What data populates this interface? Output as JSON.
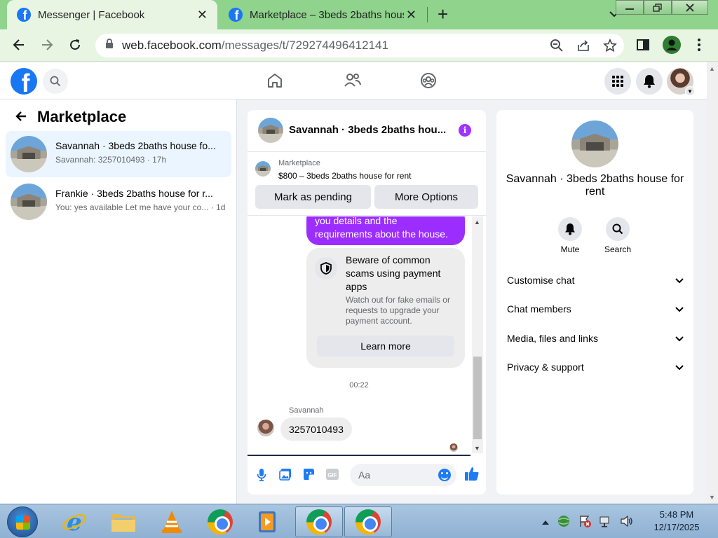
{
  "browser": {
    "tabs": [
      {
        "title": "Messenger | Facebook",
        "active": true
      },
      {
        "title": "Marketplace – 3beds 2baths hous",
        "active": false
      }
    ],
    "url_host": "web.facebook.com",
    "url_path": "/messages/t/729274496412141"
  },
  "left_panel": {
    "title": "Marketplace",
    "conversations": [
      {
        "title": "Savannah · 3beds 2baths house fo...",
        "subtitle": "Savannah: 3257010493 · 17h",
        "selected": true
      },
      {
        "title": "Frankie · 3beds 2baths house for r...",
        "subtitle": "You: yes available Let me have your co... · 1d",
        "selected": false
      }
    ]
  },
  "chat": {
    "header_name": "Savannah · 3beds 2baths hou...",
    "marketplace_label": "Marketplace",
    "listing": "$800 – 3beds 2baths house for rent",
    "mark_pending": "Mark as pending",
    "more_options": "More Options",
    "outgoing_text": "you details and the requirements about the house.",
    "scam_title": "Beware of common scams using payment apps",
    "scam_text": "Watch out for fake emails or requests to upgrade your payment account.",
    "learn_more": "Learn more",
    "timestamp": "00:22",
    "sender": "Savannah",
    "incoming_text": "3257010493",
    "composer_placeholder": "Aa"
  },
  "right_panel": {
    "name": "Savannah · 3beds 2baths house for rent",
    "actions": [
      {
        "label": "Mute"
      },
      {
        "label": "Search"
      }
    ],
    "sections": [
      "Customise chat",
      "Chat members",
      "Media, files and links",
      "Privacy & support"
    ]
  },
  "taskbar": {
    "time": "5:48 PM",
    "date": "12/17/2025"
  },
  "colors": {
    "facebook_blue": "#1877f2",
    "messenger_purple": "#9b2eff",
    "chrome_frame_green": "#8fd38c"
  }
}
